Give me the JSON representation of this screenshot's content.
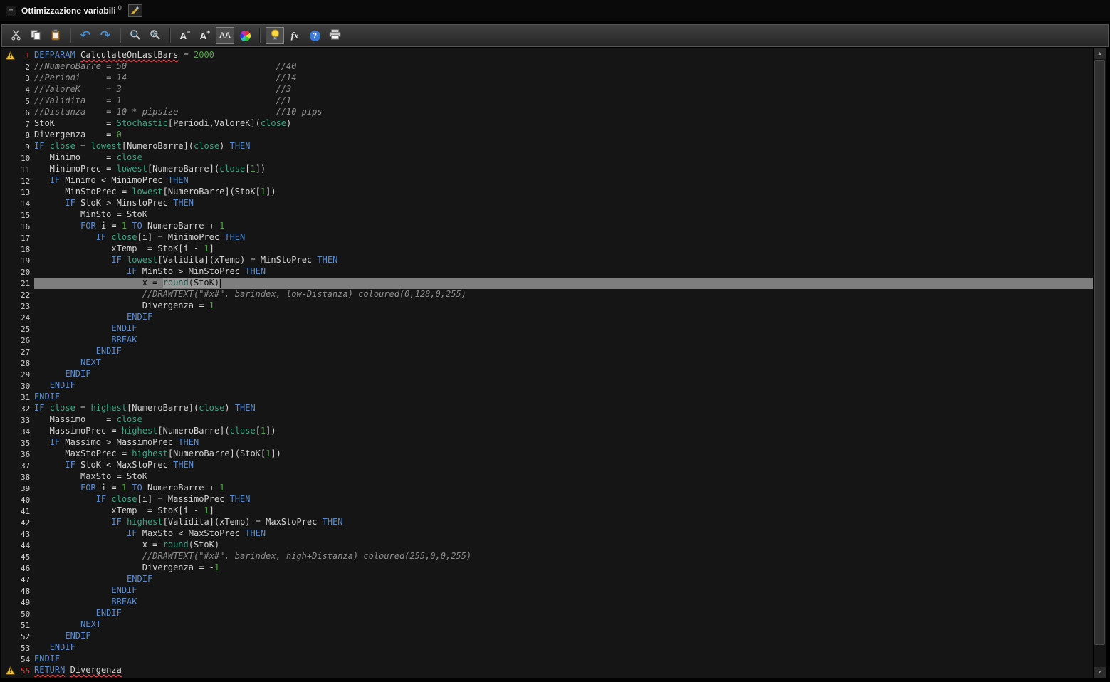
{
  "titlebar": {
    "title": "Ottimizzazione variabili",
    "badge": "0",
    "collapse_glyph": "−"
  },
  "toolbar": {
    "a": "A",
    "minus": "−",
    "plus": "+",
    "aa": "AA",
    "fx": "fx",
    "help": "?"
  },
  "icons": {
    "undo": "↶",
    "redo": "↷",
    "up": "▲",
    "down": "▼"
  },
  "colors": {
    "keyword": "#5b8bc9",
    "builtin": "#3fa383",
    "number": "#55a14a",
    "comment": "#8f8f8f",
    "warning": "#f2c230",
    "error_underline": "#e04545",
    "selected_line": "#7e7e7e",
    "editor_bg": "#151515"
  },
  "editor": {
    "language": "ProBuilder",
    "lines": [
      {
        "n": 1,
        "warn": true,
        "red": true,
        "tokens": [
          [
            "k",
            "DEFPARAM"
          ],
          [
            "p",
            " "
          ],
          [
            "e",
            "CalculateOnLastBars"
          ],
          [
            "p",
            " = "
          ],
          [
            "n",
            "2000"
          ]
        ]
      },
      {
        "n": 2,
        "tokens": [
          [
            "c",
            "//NumeroBarre = 50                             //40"
          ]
        ]
      },
      {
        "n": 3,
        "tokens": [
          [
            "c",
            "//Periodi     = 14                             //14"
          ]
        ]
      },
      {
        "n": 4,
        "tokens": [
          [
            "c",
            "//ValoreK     = 3                              //3"
          ]
        ]
      },
      {
        "n": 5,
        "tokens": [
          [
            "c",
            "//Validita    = 1                              //1"
          ]
        ]
      },
      {
        "n": 6,
        "tokens": [
          [
            "c",
            "//Distanza    = 10 * pipsize                   //10 pips"
          ]
        ]
      },
      {
        "n": 7,
        "tokens": [
          [
            "p",
            "StoK          = "
          ],
          [
            "f",
            "Stochastic"
          ],
          [
            "p",
            "[Periodi,ValoreK]("
          ],
          [
            "f",
            "close"
          ],
          [
            "p",
            ")"
          ]
        ]
      },
      {
        "n": 8,
        "tokens": [
          [
            "p",
            "Divergenza    = "
          ],
          [
            "n",
            "0"
          ]
        ]
      },
      {
        "n": 9,
        "tokens": [
          [
            "k",
            "IF"
          ],
          [
            "p",
            " "
          ],
          [
            "f",
            "close"
          ],
          [
            "p",
            " = "
          ],
          [
            "f",
            "lowest"
          ],
          [
            "p",
            "[NumeroBarre]("
          ],
          [
            "f",
            "close"
          ],
          [
            "p",
            ") "
          ],
          [
            "k",
            "THEN"
          ]
        ]
      },
      {
        "n": 10,
        "tokens": [
          [
            "p",
            "   Minimo     = "
          ],
          [
            "f",
            "close"
          ]
        ]
      },
      {
        "n": 11,
        "tokens": [
          [
            "p",
            "   MinimoPrec = "
          ],
          [
            "f",
            "lowest"
          ],
          [
            "p",
            "[NumeroBarre]("
          ],
          [
            "f",
            "close"
          ],
          [
            "p",
            "["
          ],
          [
            "n",
            "1"
          ],
          [
            "p",
            "])"
          ]
        ]
      },
      {
        "n": 12,
        "tokens": [
          [
            "p",
            "   "
          ],
          [
            "k",
            "IF"
          ],
          [
            "p",
            " Minimo < MinimoPrec "
          ],
          [
            "k",
            "THEN"
          ]
        ]
      },
      {
        "n": 13,
        "tokens": [
          [
            "p",
            "      MinStoPrec = "
          ],
          [
            "f",
            "lowest"
          ],
          [
            "p",
            "[NumeroBarre](StoK["
          ],
          [
            "n",
            "1"
          ],
          [
            "p",
            "])"
          ]
        ]
      },
      {
        "n": 14,
        "tokens": [
          [
            "p",
            "      "
          ],
          [
            "k",
            "IF"
          ],
          [
            "p",
            " StoK > MinstoPrec "
          ],
          [
            "k",
            "THEN"
          ]
        ]
      },
      {
        "n": 15,
        "tokens": [
          [
            "p",
            "         MinSto = StoK"
          ]
        ]
      },
      {
        "n": 16,
        "tokens": [
          [
            "p",
            "         "
          ],
          [
            "k",
            "FOR"
          ],
          [
            "p",
            " i = "
          ],
          [
            "n",
            "1"
          ],
          [
            "p",
            " "
          ],
          [
            "k",
            "TO"
          ],
          [
            "p",
            " NumeroBarre + "
          ],
          [
            "n",
            "1"
          ]
        ]
      },
      {
        "n": 17,
        "tokens": [
          [
            "p",
            "            "
          ],
          [
            "k",
            "IF"
          ],
          [
            "p",
            " "
          ],
          [
            "f",
            "close"
          ],
          [
            "p",
            "[i] = MinimoPrec "
          ],
          [
            "k",
            "THEN"
          ]
        ]
      },
      {
        "n": 18,
        "tokens": [
          [
            "p",
            "               xTemp  = StoK[i - "
          ],
          [
            "n",
            "1"
          ],
          [
            "p",
            "]"
          ]
        ]
      },
      {
        "n": 19,
        "tokens": [
          [
            "p",
            "               "
          ],
          [
            "k",
            "IF"
          ],
          [
            "p",
            " "
          ],
          [
            "f",
            "lowest"
          ],
          [
            "p",
            "[Validita](xTemp) = MinStoPrec "
          ],
          [
            "k",
            "THEN"
          ]
        ]
      },
      {
        "n": 20,
        "tokens": [
          [
            "p",
            "                  "
          ],
          [
            "k",
            "IF"
          ],
          [
            "p",
            " MinSto > MinStoPrec "
          ],
          [
            "k",
            "THEN"
          ]
        ]
      },
      {
        "n": 21,
        "sel": true,
        "tokens": [
          [
            "sd",
            "                     x = "
          ],
          [
            "occf",
            "round"
          ],
          [
            "occp",
            "(StoK)"
          ],
          [
            "caret",
            ""
          ]
        ]
      },
      {
        "n": 22,
        "tokens": [
          [
            "c",
            "                     //DRAWTEXT(\"#x#\", barindex, low-Distanza) coloured(0,128,0,255)"
          ]
        ]
      },
      {
        "n": 23,
        "tokens": [
          [
            "p",
            "                     Divergenza = "
          ],
          [
            "n",
            "1"
          ]
        ]
      },
      {
        "n": 24,
        "tokens": [
          [
            "p",
            "                  "
          ],
          [
            "k",
            "ENDIF"
          ]
        ]
      },
      {
        "n": 25,
        "tokens": [
          [
            "p",
            "               "
          ],
          [
            "k",
            "ENDIF"
          ]
        ]
      },
      {
        "n": 26,
        "tokens": [
          [
            "p",
            "               "
          ],
          [
            "k",
            "BREAK"
          ]
        ]
      },
      {
        "n": 27,
        "tokens": [
          [
            "p",
            "            "
          ],
          [
            "k",
            "ENDIF"
          ]
        ]
      },
      {
        "n": 28,
        "tokens": [
          [
            "p",
            "         "
          ],
          [
            "k",
            "NEXT"
          ]
        ]
      },
      {
        "n": 29,
        "tokens": [
          [
            "p",
            "      "
          ],
          [
            "k",
            "ENDIF"
          ]
        ]
      },
      {
        "n": 30,
        "tokens": [
          [
            "p",
            "   "
          ],
          [
            "k",
            "ENDIF"
          ]
        ]
      },
      {
        "n": 31,
        "tokens": [
          [
            "k",
            "ENDIF"
          ]
        ]
      },
      {
        "n": 32,
        "tokens": [
          [
            "k",
            "IF"
          ],
          [
            "p",
            " "
          ],
          [
            "f",
            "close"
          ],
          [
            "p",
            " = "
          ],
          [
            "f",
            "highest"
          ],
          [
            "p",
            "[NumeroBarre]("
          ],
          [
            "f",
            "close"
          ],
          [
            "p",
            ") "
          ],
          [
            "k",
            "THEN"
          ]
        ]
      },
      {
        "n": 33,
        "tokens": [
          [
            "p",
            "   Massimo    = "
          ],
          [
            "f",
            "close"
          ]
        ]
      },
      {
        "n": 34,
        "tokens": [
          [
            "p",
            "   MassimoPrec = "
          ],
          [
            "f",
            "highest"
          ],
          [
            "p",
            "[NumeroBarre]("
          ],
          [
            "f",
            "close"
          ],
          [
            "p",
            "["
          ],
          [
            "n",
            "1"
          ],
          [
            "p",
            "])"
          ]
        ]
      },
      {
        "n": 35,
        "tokens": [
          [
            "p",
            "   "
          ],
          [
            "k",
            "IF"
          ],
          [
            "p",
            " Massimo > MassimoPrec "
          ],
          [
            "k",
            "THEN"
          ]
        ]
      },
      {
        "n": 36,
        "tokens": [
          [
            "p",
            "      MaxStoPrec = "
          ],
          [
            "f",
            "highest"
          ],
          [
            "p",
            "[NumeroBarre](StoK["
          ],
          [
            "n",
            "1"
          ],
          [
            "p",
            "])"
          ]
        ]
      },
      {
        "n": 37,
        "tokens": [
          [
            "p",
            "      "
          ],
          [
            "k",
            "IF"
          ],
          [
            "p",
            " StoK < MaxStoPrec "
          ],
          [
            "k",
            "THEN"
          ]
        ]
      },
      {
        "n": 38,
        "tokens": [
          [
            "p",
            "         MaxSto = StoK"
          ]
        ]
      },
      {
        "n": 39,
        "tokens": [
          [
            "p",
            "         "
          ],
          [
            "k",
            "FOR"
          ],
          [
            "p",
            " i = "
          ],
          [
            "n",
            "1"
          ],
          [
            "p",
            " "
          ],
          [
            "k",
            "TO"
          ],
          [
            "p",
            " NumeroBarre + "
          ],
          [
            "n",
            "1"
          ]
        ]
      },
      {
        "n": 40,
        "tokens": [
          [
            "p",
            "            "
          ],
          [
            "k",
            "IF"
          ],
          [
            "p",
            " "
          ],
          [
            "f",
            "close"
          ],
          [
            "p",
            "[i] = MassimoPrec "
          ],
          [
            "k",
            "THEN"
          ]
        ]
      },
      {
        "n": 41,
        "tokens": [
          [
            "p",
            "               xTemp  = StoK[i - "
          ],
          [
            "n",
            "1"
          ],
          [
            "p",
            "]"
          ]
        ]
      },
      {
        "n": 42,
        "tokens": [
          [
            "p",
            "               "
          ],
          [
            "k",
            "IF"
          ],
          [
            "p",
            " "
          ],
          [
            "f",
            "highest"
          ],
          [
            "p",
            "[Validita](xTemp) = MaxStoPrec "
          ],
          [
            "k",
            "THEN"
          ]
        ]
      },
      {
        "n": 43,
        "tokens": [
          [
            "p",
            "                  "
          ],
          [
            "k",
            "IF"
          ],
          [
            "p",
            " MaxSto < MaxStoPrec "
          ],
          [
            "k",
            "THEN"
          ]
        ]
      },
      {
        "n": 44,
        "tokens": [
          [
            "p",
            "                     x = "
          ],
          [
            "f",
            "round"
          ],
          [
            "p",
            "(StoK)"
          ]
        ]
      },
      {
        "n": 45,
        "tokens": [
          [
            "c",
            "                     //DRAWTEXT(\"#x#\", barindex, high+Distanza) coloured(255,0,0,255)"
          ]
        ]
      },
      {
        "n": 46,
        "tokens": [
          [
            "p",
            "                     Divergenza = -"
          ],
          [
            "n",
            "1"
          ]
        ]
      },
      {
        "n": 47,
        "tokens": [
          [
            "p",
            "                  "
          ],
          [
            "k",
            "ENDIF"
          ]
        ]
      },
      {
        "n": 48,
        "tokens": [
          [
            "p",
            "               "
          ],
          [
            "k",
            "ENDIF"
          ]
        ]
      },
      {
        "n": 49,
        "tokens": [
          [
            "p",
            "               "
          ],
          [
            "k",
            "BREAK"
          ]
        ]
      },
      {
        "n": 50,
        "tokens": [
          [
            "p",
            "            "
          ],
          [
            "k",
            "ENDIF"
          ]
        ]
      },
      {
        "n": 51,
        "tokens": [
          [
            "p",
            "         "
          ],
          [
            "k",
            "NEXT"
          ]
        ]
      },
      {
        "n": 52,
        "tokens": [
          [
            "p",
            "      "
          ],
          [
            "k",
            "ENDIF"
          ]
        ]
      },
      {
        "n": 53,
        "tokens": [
          [
            "p",
            "   "
          ],
          [
            "k",
            "ENDIF"
          ]
        ]
      },
      {
        "n": 54,
        "tokens": [
          [
            "k",
            "ENDIF"
          ]
        ]
      },
      {
        "n": 55,
        "warn": true,
        "red": true,
        "tokens": [
          [
            "ek",
            "RETURN"
          ],
          [
            "p",
            " "
          ],
          [
            "e",
            "Divergenza"
          ]
        ]
      }
    ]
  }
}
